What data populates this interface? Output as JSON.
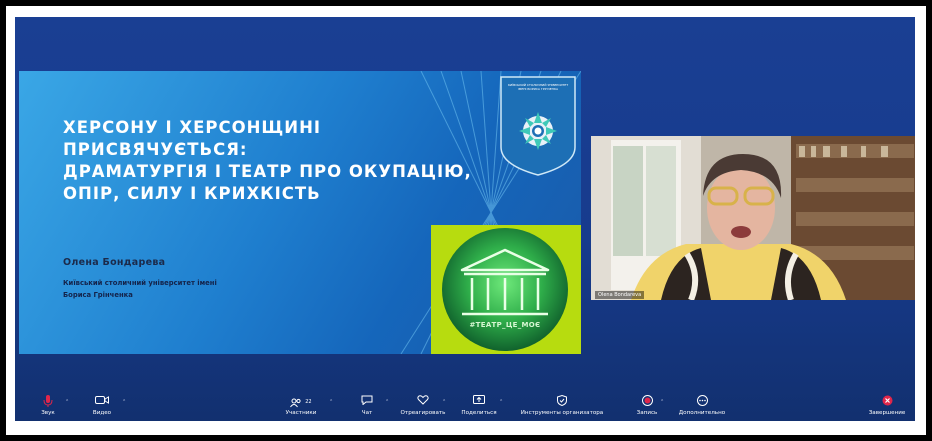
{
  "slide": {
    "title_lines": [
      "ХЕРСОНУ І ХЕРСОНЩИНІ",
      "ПРИСВЯЧУЄТЬСЯ:",
      "ДРАМАТУРГІЯ І ТЕАТР ПРО ОКУПАЦІЮ,",
      "ОПІР, СИЛУ І КРИХКІСТЬ"
    ],
    "author": "Олена Бондарева",
    "affiliation_lines": [
      "Київський столичний університет імені",
      "Бориса Грінченка"
    ],
    "crest_text": "КИЇВСЬКИЙ СТОЛИЧНИЙ УНІВЕРСИТЕТ ІМЕНІ БОРИСА ГРІНЧЕНКА",
    "logo_hashtag": "#ТЕАТР_ЦЕ_МОЄ"
  },
  "participant": {
    "name": "Olena Bondareva"
  },
  "toolbar": {
    "audio": "Звук",
    "video": "Видео",
    "participants": "Участники",
    "participants_count": "22",
    "chat": "Чат",
    "react": "Отреагировать",
    "share": "Поделиться",
    "host_tools": "Инструменты организатора",
    "record": "Запись",
    "more": "Дополнительно",
    "end": "Завершение"
  },
  "colors": {
    "meeting_bg": "#173b8d",
    "slide_bg": "#1f7fcf",
    "logo_bg": "#b7dc0f",
    "record_red": "#e0264a"
  }
}
